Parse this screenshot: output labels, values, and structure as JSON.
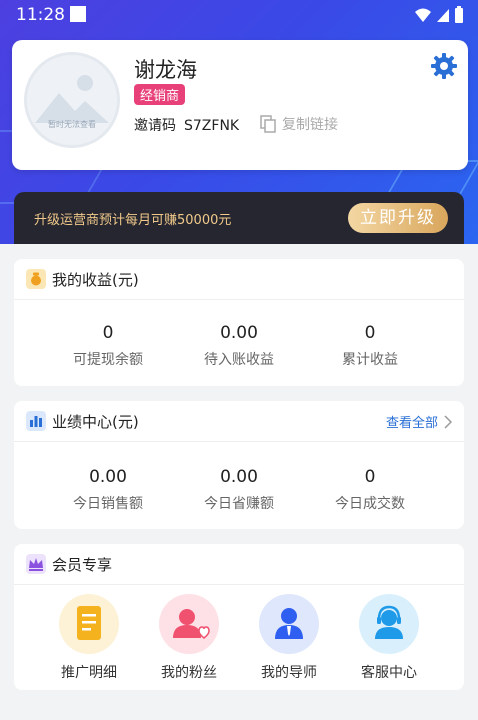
{
  "status": {
    "time": "11:28"
  },
  "profile": {
    "name": "谢龙海",
    "role_badge": "经销商",
    "invite_label": "邀请码",
    "invite_code": "S7ZFNK",
    "copy_link": "复制链接",
    "avatar_caption": "暂时无法查看"
  },
  "upgrade": {
    "text": "升级运营商预计每月可赚50000元",
    "button": "立即升级"
  },
  "earnings": {
    "title": "我的收益(元)",
    "items": [
      {
        "value": "0",
        "label": "可提现余额"
      },
      {
        "value": "0.00",
        "label": "待入账收益"
      },
      {
        "value": "0",
        "label": "累计收益"
      }
    ]
  },
  "performance": {
    "title": "业绩中心(元)",
    "view_all": "查看全部",
    "items": [
      {
        "value": "0.00",
        "label": "今日销售额"
      },
      {
        "value": "0.00",
        "label": "今日省赚额"
      },
      {
        "value": "0",
        "label": "今日成交数"
      }
    ]
  },
  "member": {
    "title": "会员专享",
    "tools": [
      {
        "label": "推广明细",
        "icon": "document-icon"
      },
      {
        "label": "我的粉丝",
        "icon": "fans-icon"
      },
      {
        "label": "我的导师",
        "icon": "mentor-icon"
      },
      {
        "label": "客服中心",
        "icon": "headset-icon"
      }
    ]
  },
  "colors": {
    "accent": "#2a6fd6",
    "badge": "#e8417a",
    "gold": "#f0c98a"
  }
}
